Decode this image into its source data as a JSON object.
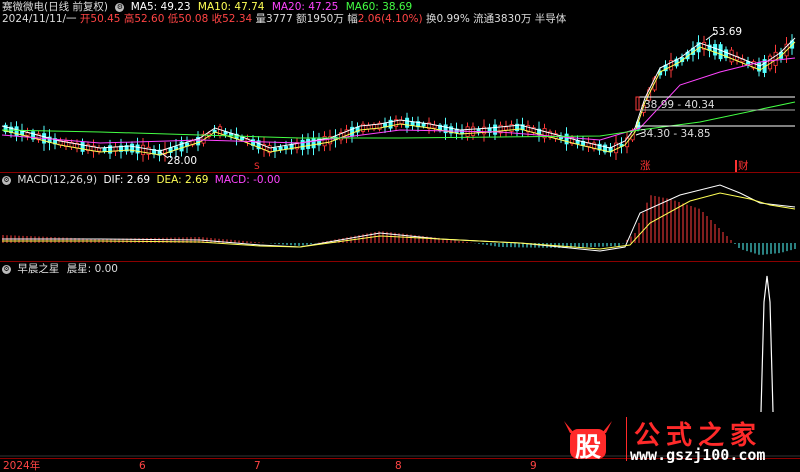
{
  "header": {
    "stock_name": "赛微微电(日线 前复权)",
    "ma": [
      {
        "label": "MA5: 49.23",
        "color": "#ffffff"
      },
      {
        "label": "MA10: 47.74",
        "color": "#ffff55"
      },
      {
        "label": "MA20: 47.25",
        "color": "#ff44ff"
      },
      {
        "label": "MA60: 38.69",
        "color": "#44ff44"
      }
    ],
    "date": "2024/11/11/一",
    "ohlc": [
      {
        "label": "开",
        "value": "50.45",
        "color": "#ff4444"
      },
      {
        "label": "高",
        "value": "52.60",
        "color": "#ff4444"
      },
      {
        "label": "低",
        "value": "50.08",
        "color": "#ff4444"
      },
      {
        "label": "收",
        "value": "52.34",
        "color": "#ff4444"
      }
    ],
    "volume": {
      "label": "量",
      "value": "3777"
    },
    "amount": {
      "label": "额",
      "value": "1950万"
    },
    "change": {
      "label": "幅",
      "value": "2.06(4.10%)",
      "color": "#ff4444"
    },
    "turnover": "换0.99%",
    "float": "流通3830万",
    "sector": "半导体"
  },
  "price_chart": {
    "annotations": {
      "high_price": "53.69",
      "low_price": "28.00",
      "band_upper": "38.99 - 40.34",
      "band_lower": "34.30 - 34.85",
      "marker_zhang": "涨",
      "marker_cai": "财",
      "marker_s": "S"
    }
  },
  "macd": {
    "title": "MACD(12,26,9)",
    "dif": "DIF: 2.69",
    "dea": "DEA: 2.69",
    "macd": "MACD: -0.00"
  },
  "indicator": {
    "title": "早晨之星",
    "value_label": "晨星: 0.00"
  },
  "x_axis": {
    "labels": [
      "2024年",
      "6",
      "7",
      "8",
      "9"
    ]
  },
  "watermark": {
    "logo": "股",
    "name": "公式之家",
    "url": "www.gszj100.com"
  }
}
